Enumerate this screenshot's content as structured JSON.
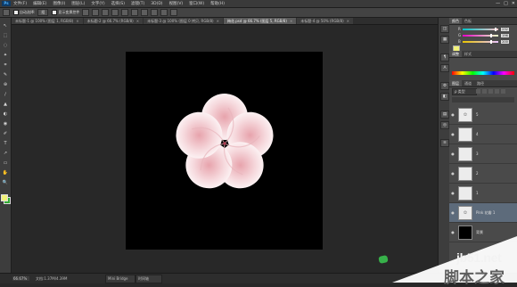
{
  "menubar": {
    "logo": "Ps",
    "items": [
      "文件(F)",
      "编辑(E)",
      "图像(I)",
      "图层(L)",
      "文字(Y)",
      "选择(S)",
      "滤镜(T)",
      "3D(D)",
      "视图(V)",
      "窗口(W)",
      "帮助(H)"
    ],
    "win_min": "—",
    "win_max": "□",
    "win_close": "✕"
  },
  "optbar": {
    "auto_select_label": "自动选择:",
    "auto_select_value": "组",
    "show_transform_label": "显示变换控件"
  },
  "tabs": [
    {
      "label": "未标题-1 @ 100% (图层 1, RGB/8)",
      "close": "×",
      "active": false
    },
    {
      "label": "未标题-2 @ 66.7% (RGB/8)",
      "close": "×",
      "active": false
    },
    {
      "label": "未标题-3 @ 100% (图层 0 拷贝, RGB/8)",
      "close": "×",
      "active": false
    },
    {
      "label": "梅花.psd @ 66.7% (图层 5, RGB/8)",
      "close": "×",
      "active": true
    },
    {
      "label": "未标题-4 @ 50% (RGB/8)",
      "close": "×",
      "active": false
    }
  ],
  "tools": [
    "↖",
    "⬚",
    "◌",
    "✦",
    "⌗",
    "✎",
    "⊕",
    "∕",
    "▲",
    "◐",
    "◉",
    "✐",
    "T",
    "↗",
    "▭",
    "✋",
    "🔍"
  ],
  "colors": {
    "canvas_bg": "#000000",
    "petal_edge": "#f6d9dd",
    "petal_inner": "#e7a3ac",
    "center": "#b03b52",
    "foreground": "#f2f27a",
    "background": "#33aa33"
  },
  "dock_icons": [
    "◫",
    "▦",
    "¶",
    "A",
    "⚙",
    "◧",
    "▤",
    "◎",
    "≡"
  ],
  "panels": {
    "color_tabs": [
      "颜色",
      "色板"
    ],
    "sliders": [
      {
        "label": "R",
        "value": "232",
        "level": 0.91
      },
      {
        "label": "G",
        "value": "196",
        "level": 0.77
      },
      {
        "label": "B",
        "value": "200",
        "level": 0.78
      }
    ],
    "adjust_tabs": [
      "调整",
      "样式"
    ],
    "layers_tabs": [
      "图层",
      "通道",
      "路径"
    ],
    "layer_kind": "ρ 类型",
    "layers": [
      {
        "name": "5",
        "eye": "●"
      },
      {
        "name": "4",
        "eye": "●"
      },
      {
        "name": "3",
        "eye": "●"
      },
      {
        "name": "2",
        "eye": "●"
      },
      {
        "name": "1",
        "eye": "●"
      },
      {
        "name": "Pink 花瓣 1",
        "eye": "●"
      },
      {
        "name": "背景",
        "eye": "●"
      }
    ]
  },
  "status": {
    "zoom": "66.67%",
    "doc": "文档:1.37M/4.39M",
    "mini1": "Mini Bridge",
    "mini2": "时间轴"
  },
  "watermark": {
    "url": "jb51.net",
    "cn": "脚本之家"
  }
}
